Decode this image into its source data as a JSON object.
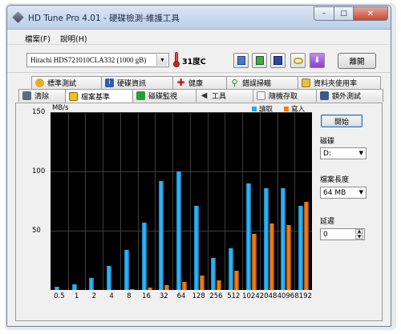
{
  "window": {
    "title": "HD Tune Pro 4.01 - 硬碟檢測-維護工具",
    "min_glyph": "–",
    "max_glyph": "□",
    "close_glyph": "✕"
  },
  "menu": [
    {
      "label": "檔案(F)"
    },
    {
      "label": "說明(H)"
    }
  ],
  "toolbar": {
    "drive": "Hitachi HDS721010CLA332  (1000 gB)",
    "temperature": "31度C",
    "exit_label": "離開"
  },
  "tabs_top": [
    {
      "label": "標準測試",
      "icon": "stopwatch-icon"
    },
    {
      "label": "硬碟資訊",
      "icon": "info-icon"
    },
    {
      "label": "健康",
      "icon": "health-cross-icon"
    },
    {
      "label": "錯誤掃瞄",
      "icon": "magnifier-icon"
    },
    {
      "label": "資料夾使用率",
      "icon": "folder-icon"
    }
  ],
  "tabs_bottom": [
    {
      "label": "清除",
      "icon": "trash-icon"
    },
    {
      "label": "檔案基準",
      "icon": "file-benchmark-icon"
    },
    {
      "label": "磁碟監視",
      "icon": "monitor-chart-icon"
    },
    {
      "label": "工具",
      "icon": "speaker-icon"
    },
    {
      "label": "隨機存取",
      "icon": "random-access-icon"
    },
    {
      "label": "額外測試",
      "icon": "extra-tests-icon"
    }
  ],
  "active_tab": "檔案基準",
  "side": {
    "start_label": "開始",
    "drive_label": "磁碟",
    "drive_value": "D:",
    "file_length_label": "檔案長度",
    "file_length_value": "64 MB",
    "delay_label": "延遲",
    "delay_value": "0"
  },
  "colors": {
    "read": "#2aa9ec",
    "write": "#f07a10",
    "plot_background": "#000000"
  },
  "chart_data": {
    "type": "bar",
    "ylabel": "MB/s",
    "ylim": [
      0,
      150
    ],
    "yticks": [
      50,
      100,
      150
    ],
    "categories": [
      "0.5",
      "1",
      "2",
      "4",
      "8",
      "16",
      "32",
      "64",
      "128",
      "256",
      "512",
      "1024",
      "2048",
      "4096",
      "8192"
    ],
    "series": [
      {
        "name": "讀取",
        "values": [
          3,
          5,
          10,
          20,
          34,
          57,
          92,
          100,
          71,
          27,
          35,
          90,
          86,
          86,
          71
        ]
      },
      {
        "name": "寫入",
        "values": [
          0,
          0,
          0,
          0,
          1,
          2,
          4,
          7,
          12,
          8,
          16,
          47,
          56,
          55,
          74
        ]
      }
    ],
    "grid": true,
    "legend_position": "top-right"
  }
}
